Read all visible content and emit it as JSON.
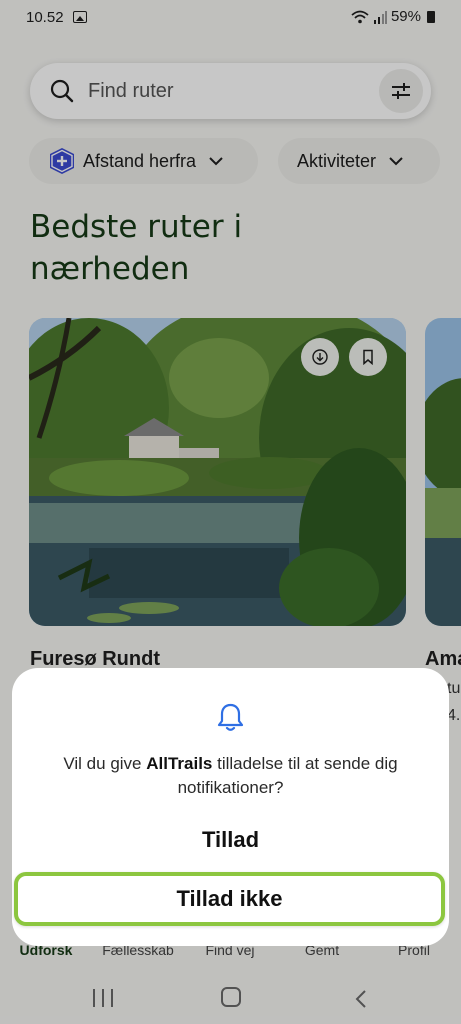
{
  "status_bar": {
    "time": "10.52",
    "battery": "59%"
  },
  "search": {
    "placeholder": "Find ruter"
  },
  "filters": {
    "distance_label": "Afstand herfra",
    "activities_label": "Aktiviteter"
  },
  "section": {
    "title": "Bedste ruter i nærheden"
  },
  "routes": [
    {
      "name": "Furesø Rundt"
    },
    {
      "name": "Ama",
      "sub1": "tu",
      "sub2": "4."
    }
  ],
  "bottom_nav": {
    "items": [
      "Udforsk",
      "Fællesskab",
      "Find vej",
      "Gemt",
      "Profil"
    ]
  },
  "dialog": {
    "message_pre": "Vil du give ",
    "app_name": "AllTrails",
    "message_post": " tilladelse til at sende dig notifikationer?",
    "allow_label": "Tillad",
    "deny_label": "Tillad ikke"
  },
  "colors": {
    "brand_green": "#173a17",
    "highlight": "#8cc63f",
    "accent_blue": "#2f6fe4"
  },
  "icons": [
    "search-icon",
    "filter-icon",
    "shield-plus-icon",
    "chevron-down-icon",
    "download-icon",
    "bookmark-icon",
    "bell-icon"
  ]
}
